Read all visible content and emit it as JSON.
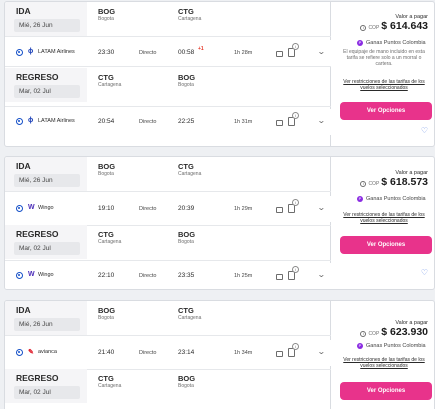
{
  "cards": [
    {
      "outbound": {
        "type": "IDA",
        "date": "Mié, 26 Jun",
        "from_code": "BOG",
        "from_city": "Bogota",
        "to_code": "CTG",
        "to_city": "Cartagena",
        "airline": "LATAM Airlines",
        "airline_logo_color": "#1a3fb7",
        "depart": "23:30",
        "stops": "Directo",
        "arrive": "00:58",
        "next_day": "+1",
        "duration": "1h 28m"
      },
      "return": {
        "type": "REGRESO",
        "date": "Mar, 02 Jul",
        "from_code": "CTG",
        "from_city": "Cartagena",
        "to_code": "BOG",
        "to_city": "Bogota",
        "airline": "LATAM Airlines",
        "airline_logo_color": "#1a3fb7",
        "depart": "20:54",
        "stops": "Directo",
        "arrive": "22:25",
        "duration": "1h 31m"
      },
      "price": {
        "label": "Valor a pagar",
        "currency": "COP",
        "amount": "$ 614.643",
        "points": "Ganas Puntos Colombia",
        "note": "El equipaje de mano incluido en esta tarifa se refiere solo a un morral o cartera.",
        "restrictions": "Ver restricciones de las tarifas de los vuelos seleccionados",
        "button": "Ver Opciones"
      }
    },
    {
      "outbound": {
        "type": "IDA",
        "date": "Mié, 26 Jun",
        "from_code": "BOG",
        "from_city": "Bogota",
        "to_code": "CTG",
        "to_city": "Cartagena",
        "airline": "Wingo",
        "airline_logo_color": "#4a2bb8",
        "depart": "19:10",
        "stops": "Directo",
        "arrive": "20:39",
        "duration": "1h 29m"
      },
      "return": {
        "type": "REGRESO",
        "date": "Mar, 02 Jul",
        "from_code": "CTG",
        "from_city": "Cartagena",
        "to_code": "BOG",
        "to_city": "Bogota",
        "airline": "Wingo",
        "airline_logo_color": "#4a2bb8",
        "depart": "22:10",
        "stops": "Directo",
        "arrive": "23:35",
        "duration": "1h 25m"
      },
      "price": {
        "label": "Valor a pagar",
        "currency": "COP",
        "amount": "$ 618.573",
        "points": "Ganas Puntos Colombia",
        "restrictions": "Ver restricciones de las tarifas de los vuelos seleccionados",
        "button": "Ver Opciones"
      }
    },
    {
      "outbound": {
        "type": "IDA",
        "date": "Mié, 26 Jun",
        "from_code": "BOG",
        "from_city": "Bogota",
        "to_code": "CTG",
        "to_city": "Cartagena",
        "airline": "avianca",
        "airline_logo_color": "#e0202e",
        "depart": "21:40",
        "stops": "Directo",
        "arrive": "23:14",
        "duration": "1h 34m"
      },
      "return": {
        "type": "REGRESO",
        "date": "Mar, 02 Jul",
        "from_code": "CTG",
        "from_city": "Cartagena",
        "to_code": "BOG",
        "to_city": "Bogota"
      },
      "price": {
        "label": "Valor a pagar",
        "currency": "COP",
        "amount": "$ 623.930",
        "points": "Ganas Puntos Colombia",
        "restrictions": "Ver restricciones de las tarifas de los vuelos seleccionados",
        "button": "Ver Opciones"
      }
    }
  ]
}
